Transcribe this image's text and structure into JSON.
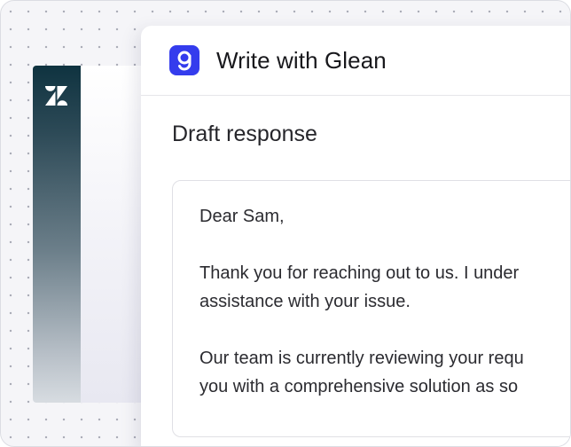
{
  "app": {
    "sidebar_icon": "zendesk-icon",
    "panel_logo_icon": "glean-icon",
    "title": "Write with Glean"
  },
  "draft": {
    "heading": "Draft response",
    "greeting": "Dear Sam,",
    "paragraph1": [
      "Thank you for reaching out to us. I under",
      "assistance with your issue."
    ],
    "paragraph2": [
      "Our team is currently reviewing your requ",
      "you with a comprehensive solution as so"
    ]
  },
  "colors": {
    "glean_brand": "#343ced",
    "zendesk_sidebar": "#0f3340",
    "text": "#2b2b30"
  }
}
